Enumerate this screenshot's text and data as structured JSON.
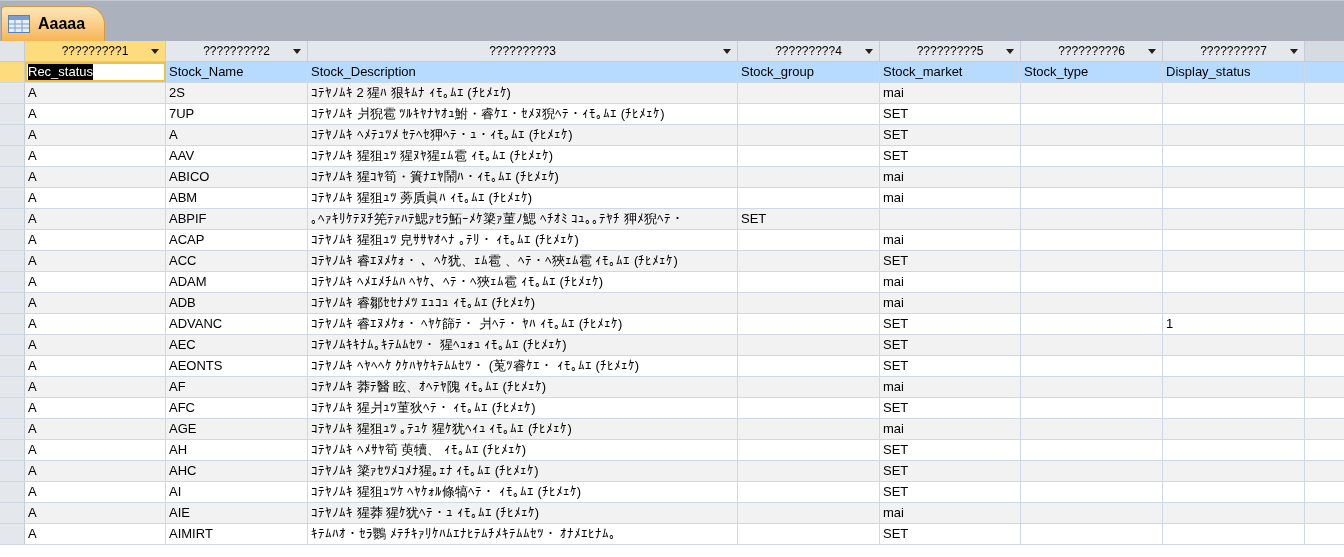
{
  "document_tab": {
    "title": "Aaaaa",
    "selected": true
  },
  "columns": [
    {
      "label": "?????????1",
      "selected": true
    },
    {
      "label": "?????????2",
      "selected": false
    },
    {
      "label": "?????????3",
      "selected": false
    },
    {
      "label": "?????????4",
      "selected": false
    },
    {
      "label": "?????????5",
      "selected": false
    },
    {
      "label": "?????????6",
      "selected": false
    },
    {
      "label": "?????????7",
      "selected": false
    }
  ],
  "rows": [
    {
      "selected": true,
      "cells": [
        "Rec_status",
        "Stock_Name",
        "Stock_Description",
        "Stock_group",
        "Stock_market",
        "Stock_type",
        "Display_status"
      ]
    },
    {
      "selected": false,
      "cells": [
        "A",
        "2S",
        "ｺﾃﾔﾉﾑｷ 2 猩ﾊ 狠ｷﾑﾅ ｨﾓ｡ﾑｴ (ﾁﾋﾒｪｹ)",
        "",
        "mai",
        "",
        ""
      ]
    },
    {
      "selected": false,
      "cells": [
        "A",
        "7UP",
        "ｺﾃﾔﾉﾑｷ 爿猊雹 ﾂﾙｷﾔﾅﾔｵｭ鮒・睿ｹｴ・ｾﾒﾇ猊ﾍﾃ・ｨﾓ｡ﾑｴ (ﾁﾋﾒｪｹ)",
        "",
        "SET",
        "",
        ""
      ]
    },
    {
      "selected": false,
      "cells": [
        "A",
        "A",
        "ｺﾃﾔﾉﾑｷ ﾍﾒﾃｭﾂﾒ ｾﾃﾍｾ狎ﾍﾃ・ｭ・ｨﾓ｡ﾑｴ (ﾁﾋﾒｪｹ)",
        "",
        "SET",
        "",
        ""
      ]
    },
    {
      "selected": false,
      "cells": [
        "A",
        "AAV",
        "ｺﾃﾔﾉﾑｷ 猩狙ｭﾂ 猩ﾇﾔ猩ｪﾑ雹 ｨﾓ｡ﾑｴ (ﾁﾋﾒｪｹ)",
        "",
        "SET",
        "",
        ""
      ]
    },
    {
      "selected": false,
      "cells": [
        "A",
        "ABICO",
        "ｺﾃﾔﾉﾑｷ 猩ｺﾔ筍・簣ﾅｴﾔ鬧ﾊ・ｨﾓ｡ﾑｴ (ﾁﾋﾒｪｹ)",
        "",
        "mai",
        "",
        ""
      ]
    },
    {
      "selected": false,
      "cells": [
        "A",
        "ABM",
        "ｺﾃﾔﾉﾑｷ 猩狙ｭﾂ 蒡貭眞ﾊ ｨﾓ｡ﾑｴ (ﾁﾋﾒｪｹ)",
        "",
        "mai",
        "",
        ""
      ]
    },
    {
      "selected": false,
      "cells": [
        "A",
        "ABPIF",
        "｡ﾍｧｷﾘｹﾃﾇﾁ筅ﾃｧﾊﾃ鰓ｧｾﾗ鮖ｰﾒｹ簗ｧ菫ﾉ鰓 ﾍﾁｵﾐ ｺｭ｡｡ﾃﾔﾁ 狎ﾒ猊ﾍﾃ・",
        "SET",
        "",
        "",
        ""
      ]
    },
    {
      "selected": false,
      "cells": [
        "A",
        "ACAP",
        "ｺﾃﾔﾉﾑｷ 猩狙ｭﾂ 皃ｻｻﾔｵﾍﾅ ｡ﾃﾘ・ ｨﾓ｡ﾑｴ (ﾁﾋﾒｪｹ)",
        "",
        "mai",
        "",
        ""
      ]
    },
    {
      "selected": false,
      "cells": [
        "A",
        "ACC",
        "ｺﾃﾔﾉﾑｷ 睿ｴﾇﾒｹｫ・ 、ﾍｹ犹、ｪﾑ雹 、ﾍﾃ・ﾍ狹ｪﾑ雹 ｨﾓ｡ﾑｴ (ﾁﾋﾒｪｹ)",
        "",
        "SET",
        "",
        ""
      ]
    },
    {
      "selected": false,
      "cells": [
        "A",
        "ADAM",
        "ｺﾃﾔﾉﾑｷ ﾍﾒｴﾒﾁﾑﾊ ﾍﾔｹ、ﾍﾃ・ﾍ狹ｪﾑ雹 ｨﾓ｡ﾑｴ (ﾁﾋﾒｪｹ)",
        "",
        "mai",
        "",
        ""
      ]
    },
    {
      "selected": false,
      "cells": [
        "A",
        "ADB",
        "ｺﾃﾔﾉﾑｷ 睿鄒ｾｾﾅﾒﾂ ｴｭｺｭ ｨﾓ｡ﾑｴ (ﾁﾋﾒｪｹ)",
        "",
        "mai",
        "",
        ""
      ]
    },
    {
      "selected": false,
      "cells": [
        "A",
        "ADVANC",
        "ｺﾃﾔﾉﾑｷ 睿ｴﾇﾒｹｫ・ ﾍﾔｹ篩ﾃ・ 爿ﾍﾃ・ ﾔﾊ ｨﾓ｡ﾑｴ (ﾁﾋﾒｪｹ)",
        "",
        "SET",
        "",
        "1"
      ]
    },
    {
      "selected": false,
      "cells": [
        "A",
        "AEC",
        "ｺﾃﾔﾉﾑｷｷﾅﾑ｡ｷﾃﾑﾑｾﾂ・ 猩ﾍｭｫｭ ｨﾓ｡ﾑｴ (ﾁﾋﾒｪｹ)",
        "",
        "SET",
        "",
        ""
      ]
    },
    {
      "selected": false,
      "cells": [
        "A",
        "AEONTS",
        "ｺﾃﾔﾉﾑｷ ﾍﾔﾍﾍｹ ｸｹﾊﾔｹｷﾃﾑﾑｾﾂ・ (莵ﾂ睿ｹｴ・ ｨﾓ｡ﾑｴ (ﾁﾋﾒｪｹ)",
        "",
        "SET",
        "",
        ""
      ]
    },
    {
      "selected": false,
      "cells": [
        "A",
        "AF",
        "ｺﾃﾔﾉﾑｷ 莽ﾃ醫 眩、ｵﾍﾃﾔ隗 ｨﾓ｡ﾑｴ (ﾁﾋﾒｪｹ)",
        "",
        "mai",
        "",
        ""
      ]
    },
    {
      "selected": false,
      "cells": [
        "A",
        "AFC",
        "ｺﾃﾔﾉﾑｷ 猩爿ｭﾂ菫狄ﾍﾃ・ ｨﾓ｡ﾑｴ (ﾁﾋﾒｪｹ)",
        "",
        "SET",
        "",
        ""
      ]
    },
    {
      "selected": false,
      "cells": [
        "A",
        "AGE",
        "ｺﾃﾔﾉﾑｷ 猩狙ｭﾂ ｡ﾃｭｹ 猩ｹ犹ﾍｨｭ ｨﾓ｡ﾑｴ (ﾁﾋﾒｪｹ)",
        "",
        "mai",
        "",
        ""
      ]
    },
    {
      "selected": false,
      "cells": [
        "A",
        "AH",
        "ｺﾃﾔﾉﾑｷ ﾍﾒｻﾔ筍 萸犢、 ｨﾓ｡ﾑｴ (ﾁﾋﾒｪｹ)",
        "",
        "SET",
        "",
        ""
      ]
    },
    {
      "selected": false,
      "cells": [
        "A",
        "AHC",
        "ｺﾃﾔﾉﾑｷ 簗ｧｾﾂﾒｺﾒﾅ猩｡ｪﾅ ｨﾓ｡ﾑｴ (ﾁﾋﾒｪｹ)",
        "",
        "SET",
        "",
        ""
      ]
    },
    {
      "selected": false,
      "cells": [
        "A",
        "AI",
        "ｺﾃﾔﾉﾑｷ 猩狙ｭﾂｹ ﾍﾔｹｫﾙ條犒ﾍﾃ・ ｨﾓ｡ﾑｴ (ﾁﾋﾒｪｹ)",
        "",
        "SET",
        "",
        ""
      ]
    },
    {
      "selected": false,
      "cells": [
        "A",
        "AIE",
        "ｺﾃﾔﾉﾑｷ 猩莽 猩ｹ犹ﾍﾃ・ｭ ｨﾓ｡ﾑｴ (ﾁﾋﾒｪｹ)",
        "",
        "mai",
        "",
        ""
      ]
    },
    {
      "selected": false,
      "cells": [
        "A",
        "AIMIRT",
        "ｷﾃﾑﾊｵ・ｾﾗ鸚 ﾒﾃﾁｷｧﾘｹﾊﾑｴﾅﾋﾃﾑﾁﾒｷﾃﾑﾑｾﾂ・ ｵﾅﾒｴﾋﾅﾑ｡",
        "",
        "SET",
        "",
        ""
      ]
    }
  ]
}
